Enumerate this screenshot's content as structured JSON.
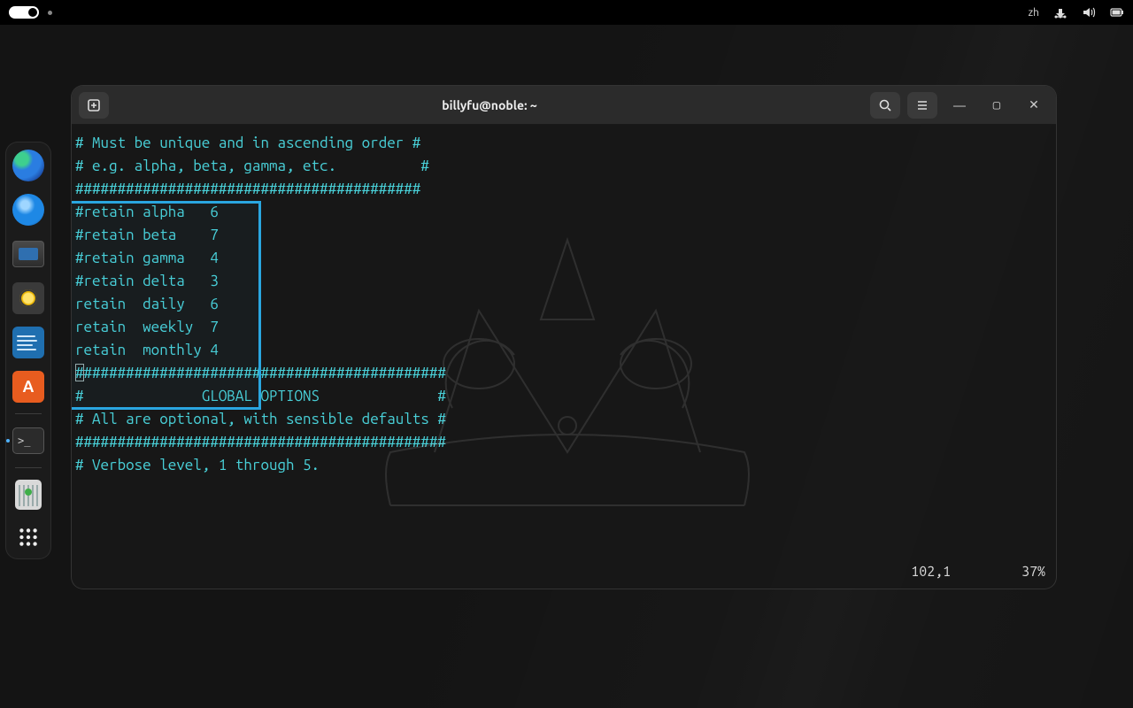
{
  "topbar": {
    "lang": "zh"
  },
  "dock": {
    "items": [
      {
        "name": "edge"
      },
      {
        "name": "thunderbird"
      },
      {
        "name": "files"
      },
      {
        "name": "rhythmbox"
      },
      {
        "name": "libreoffice-writer"
      },
      {
        "name": "software-store"
      },
      {
        "name": "terminal",
        "active": true
      },
      {
        "name": "trash"
      },
      {
        "name": "show-apps"
      }
    ]
  },
  "terminal": {
    "title": "billyfu@noble: ~",
    "lines": [
      "# Must be unique and in ascending order #",
      "# e.g. alpha, beta, gamma, etc.          #",
      "#########################################",
      "",
      "#retain alpha   6",
      "#retain beta    7",
      "#retain gamma   4",
      "#retain delta   3",
      "",
      "retain  daily   6",
      "retain  weekly  7",
      "retain  monthly 4",
      "",
      "############################################",
      "#              GLOBAL OPTIONS              #",
      "# All are optional, with sensible defaults #",
      "############################################",
      "",
      "# Verbose level, 1 through 5."
    ],
    "status_pos": "102,1",
    "status_pct": "37%"
  }
}
